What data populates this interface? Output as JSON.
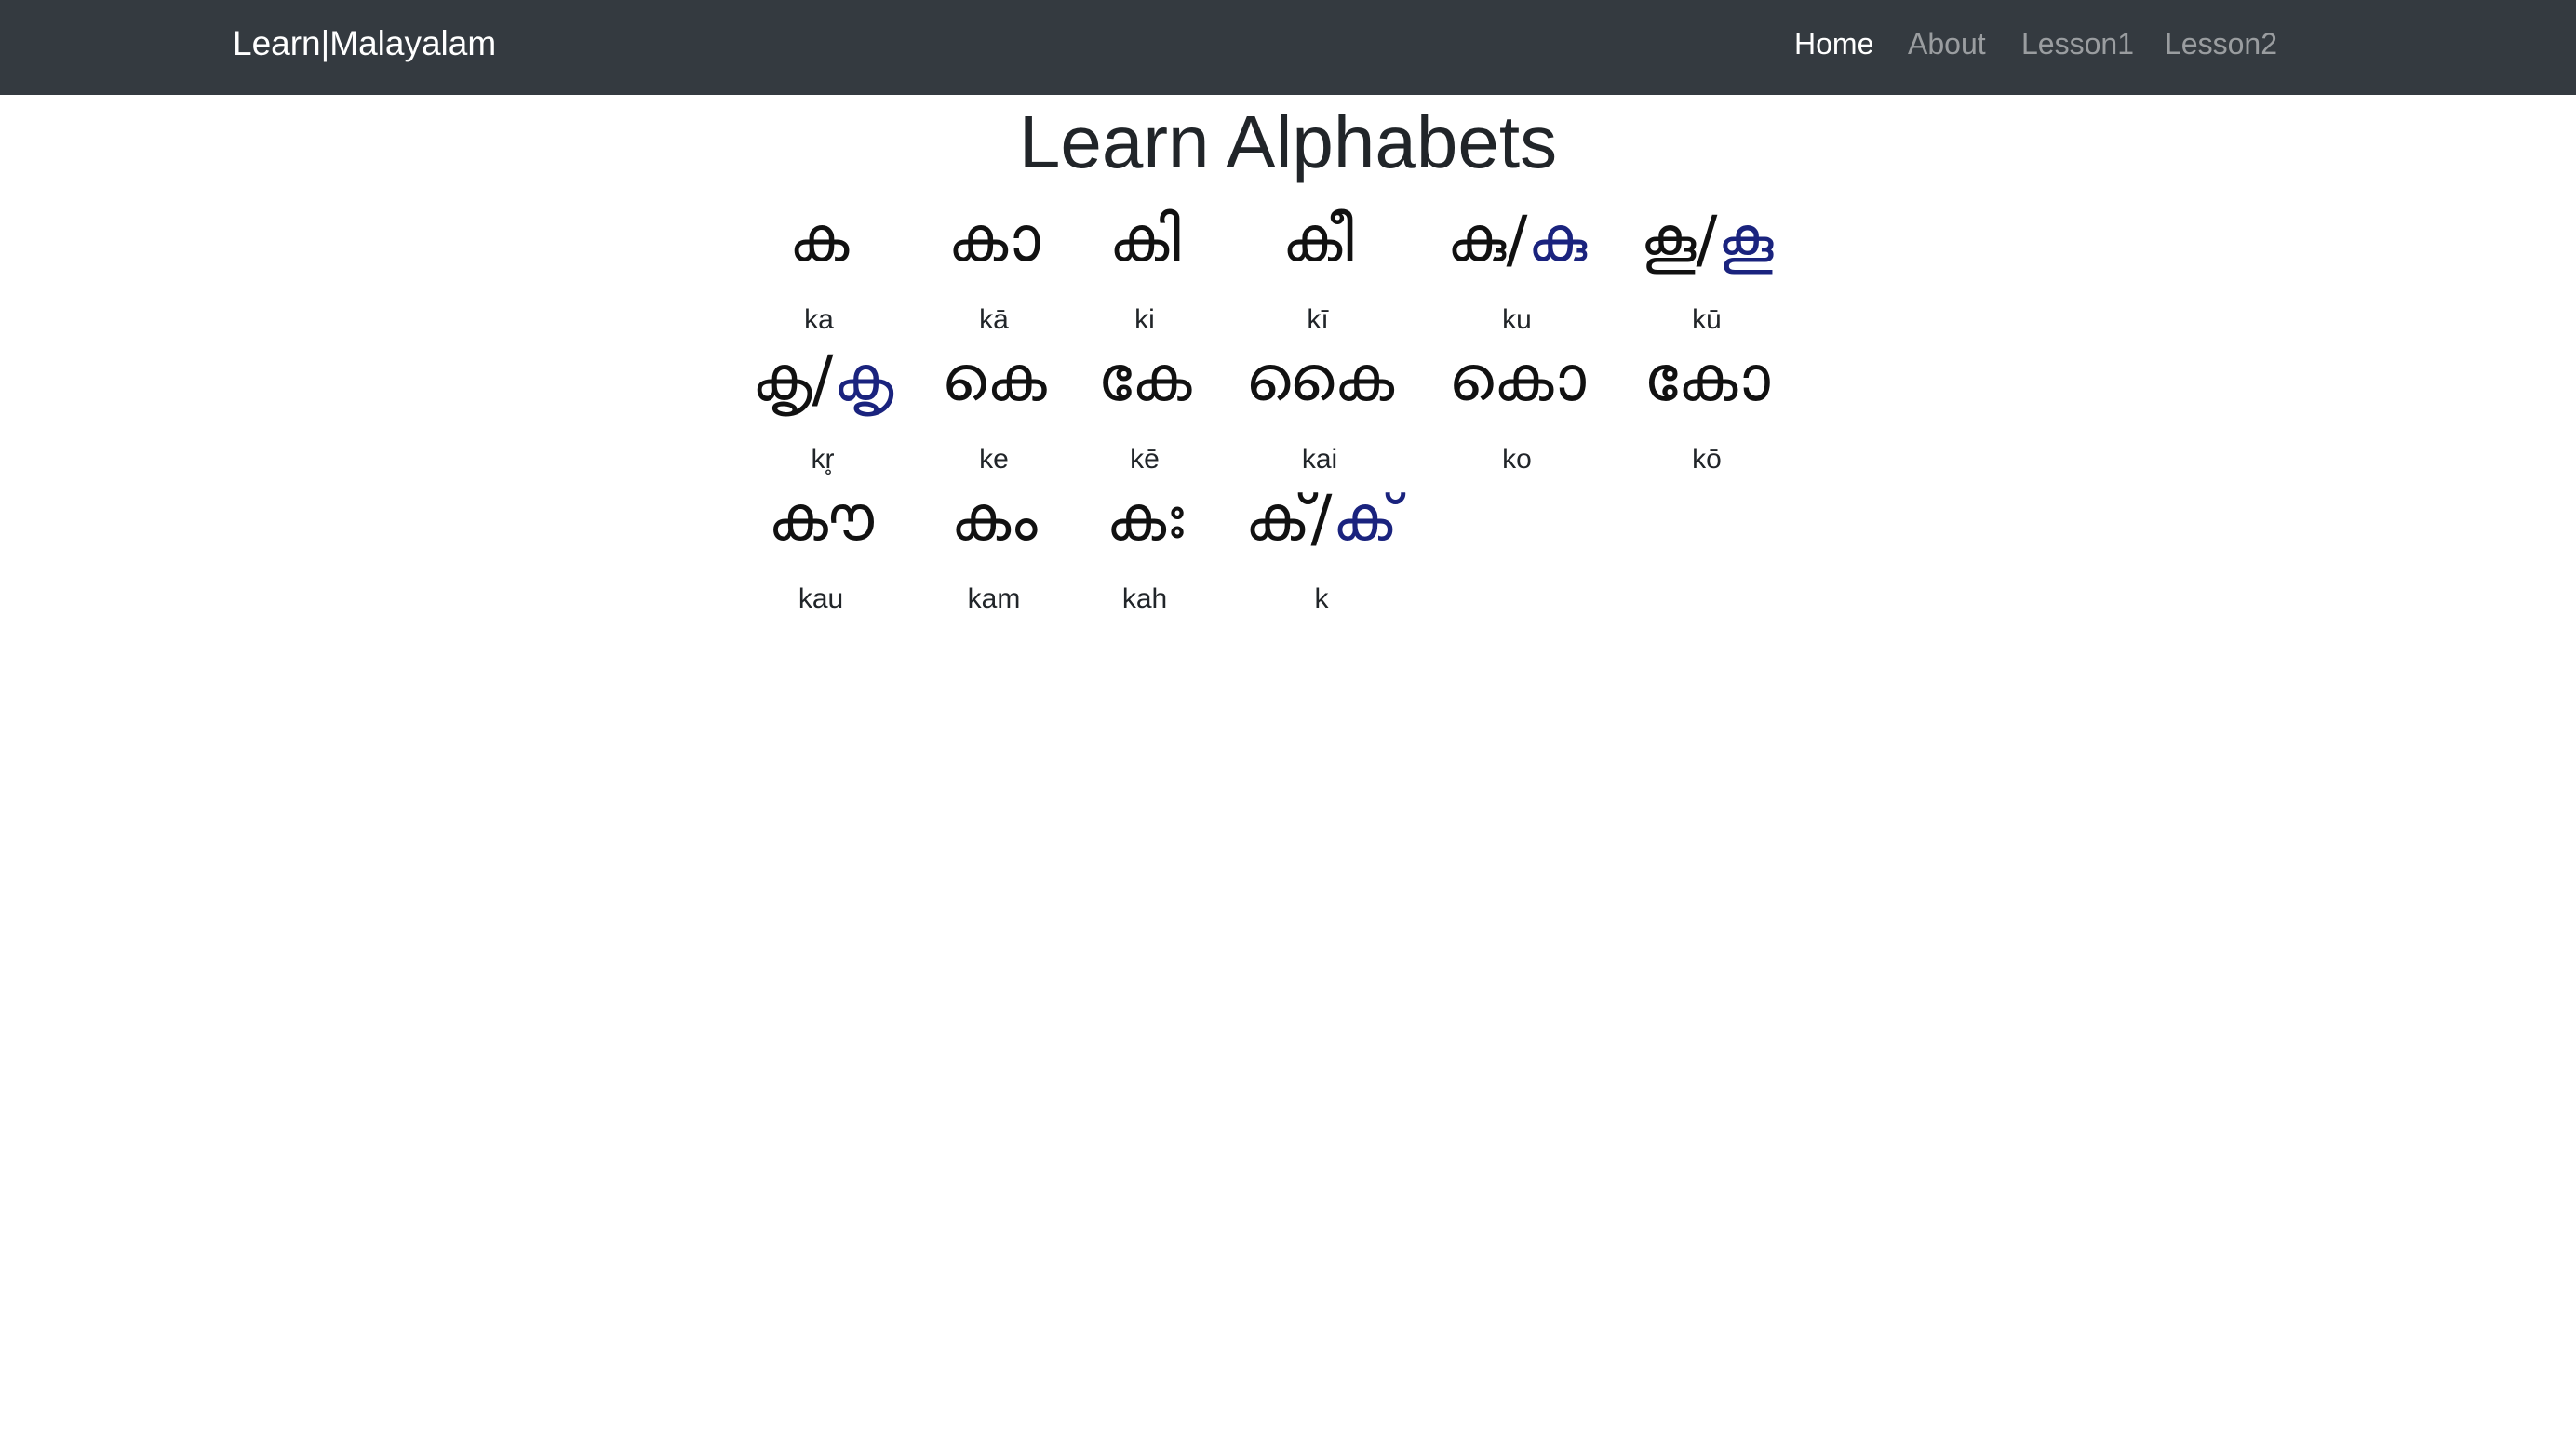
{
  "navbar": {
    "brand": "Learn|Malayalam",
    "links": [
      {
        "label": "Home",
        "active": true
      },
      {
        "label": "About",
        "active": false
      },
      {
        "label": "Lesson1",
        "active": false
      },
      {
        "label": "Lesson2",
        "active": false
      }
    ]
  },
  "main": {
    "title": "Learn Alphabets",
    "letters": [
      {
        "base": "ക",
        "sign": "",
        "sep": "",
        "alt_base": "",
        "alt_sign": "",
        "translit": "ka"
      },
      {
        "base": "ക",
        "sign": "ാ",
        "sep": "",
        "alt_base": "",
        "alt_sign": "",
        "translit": "kā"
      },
      {
        "base": "ക",
        "sign": "ി",
        "sep": "",
        "alt_base": "",
        "alt_sign": "",
        "translit": "ki"
      },
      {
        "base": "ക",
        "sign": "ീ",
        "sep": "",
        "alt_base": "",
        "alt_sign": "",
        "translit": "kī"
      },
      {
        "base": "കു",
        "sign": "",
        "sep": "/",
        "alt_base": "ക",
        "alt_sign": "ു",
        "translit": "ku"
      },
      {
        "base": "കൂ",
        "sign": "",
        "sep": "/",
        "alt_base": "ക",
        "alt_sign": "ൂ",
        "translit": "kū"
      },
      {
        "base": "കൃ",
        "sign": "",
        "sep": "/",
        "alt_base": "ക",
        "alt_sign": "ൃ",
        "translit": "kr̥"
      },
      {
        "base": "ക",
        "sign": "െ",
        "sep": "",
        "alt_base": "",
        "alt_sign": "",
        "translit": "ke"
      },
      {
        "base": "ക",
        "sign": "േ",
        "sep": "",
        "alt_base": "",
        "alt_sign": "",
        "translit": "kē"
      },
      {
        "base": "ക",
        "sign": "ൈ",
        "sep": "",
        "alt_base": "",
        "alt_sign": "",
        "translit": "kai"
      },
      {
        "base": "ക",
        "sign": "ൊ",
        "sep": "",
        "alt_base": "",
        "alt_sign": "",
        "translit": "ko"
      },
      {
        "base": "ക",
        "sign": "ോ",
        "sep": "",
        "alt_base": "",
        "alt_sign": "",
        "translit": "kō"
      },
      {
        "base": "ക",
        "sign": "ൗ",
        "sep": "",
        "alt_base": "",
        "alt_sign": "",
        "translit": "kau"
      },
      {
        "base": "ക",
        "sign": "ം",
        "sep": "",
        "alt_base": "",
        "alt_sign": "",
        "translit": "kam"
      },
      {
        "base": "ക",
        "sign": "ഃ",
        "sep": "",
        "alt_base": "",
        "alt_sign": "",
        "translit": "kah"
      },
      {
        "base": "ക്",
        "sign": "",
        "sep": "/",
        "alt_base": "ക",
        "alt_sign": "്",
        "translit": "k"
      }
    ]
  },
  "colors": {
    "navbar_bg": "#343a40",
    "consonant": "#111111",
    "vowel_sign": "#e0271b",
    "alt_consonant": "#1a237e"
  }
}
